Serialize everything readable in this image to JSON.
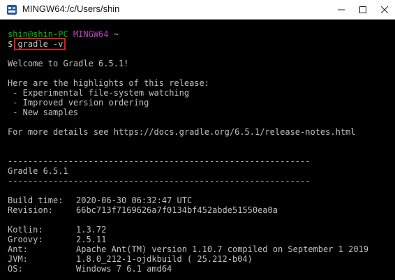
{
  "window": {
    "title": "MINGW64:/c/Users/shin",
    "icon": "mingw-icon"
  },
  "terminal": {
    "prompt_user": "shin@shin-PC",
    "prompt_system": "MINGW64",
    "prompt_path": "~",
    "prompt_symbol": "$",
    "command": "gradle -v",
    "welcome": "Welcome to Gradle 6.5.1!",
    "highlights_heading": "Here are the highlights of this release:",
    "highlights": [
      " - Experimental file-system watching",
      " - Improved version ordering",
      " - New samples"
    ],
    "details": "For more details see https://docs.gradle.org/6.5.1/release-notes.html",
    "separator": "------------------------------------------------------------",
    "version_line": "Gradle 6.5.1",
    "build_info": [
      {
        "key": "Build time:",
        "value": "2020-06-30 06:32:47 UTC"
      },
      {
        "key": "Revision:",
        "value": "66bc713f7169626a7f0134bf452abde51550ea0a"
      }
    ],
    "env_info": [
      {
        "key": "Kotlin:",
        "value": "1.3.72"
      },
      {
        "key": "Groovy:",
        "value": "2.5.11"
      },
      {
        "key": "Ant:",
        "value": "Apache Ant(TM) version 1.10.7 compiled on September 1 2019"
      },
      {
        "key": "JVM:",
        "value": "1.8.0_212-1-ojdkbuild ( 25.212-b04)"
      },
      {
        "key": "OS:",
        "value": "Windows 7 6.1 amd64"
      }
    ]
  },
  "colors": {
    "background": "#000000",
    "text": "#c0c0c0",
    "prompt_user": "#00b800",
    "prompt_system": "#c040c0",
    "prompt_path": "#c0c000",
    "highlight_box": "#e01b1b"
  }
}
